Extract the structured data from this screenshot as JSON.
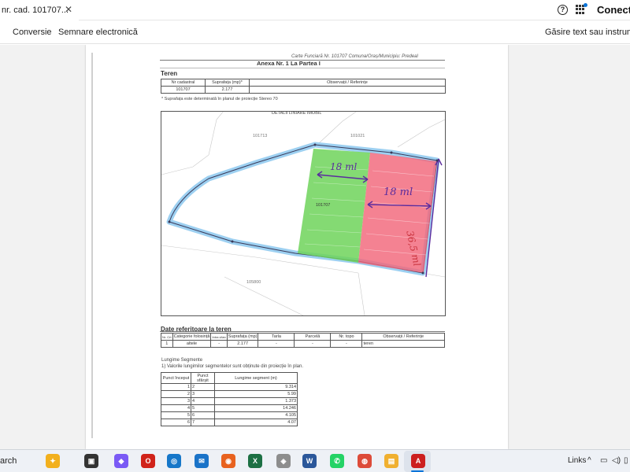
{
  "browser": {
    "tab_title": "nr. cad. 101707...",
    "tab_close": "✕",
    "help": "?",
    "profile_button": "Conecta"
  },
  "toolbar": {
    "conversion": "Conversie",
    "signatures": "Semnare electronică",
    "find_tools": "Găsire text sau instrumente"
  },
  "document": {
    "header_ref": "Carte Funciară Nr. 101707 Comuna/Oraș/Municipiu: Predeal",
    "annex_title": "Anexa Nr. 1 La Partea I",
    "teren_title": "Teren",
    "teren_headers": [
      "Nr cadastral",
      "Suprafața (mp)*",
      "Observații / Referințe"
    ],
    "teren_row": [
      "101707",
      "2.177",
      ""
    ],
    "stereo_note": "* Suprafața este determinată în planul de proiecție Stereo 70",
    "plan_title": "DETALII LINIARE IMOBIL",
    "parcel_label": "101707",
    "neighbor_labels": [
      "101713",
      "101021",
      "105800"
    ],
    "handwritten_width_1": "18 ml",
    "handwritten_width_2": "18 ml",
    "handwritten_depth": "36,5 ml",
    "date_ref_title": "Date referitoare la teren",
    "date_ref_headers": [
      "Nr. Crt",
      "Categorie folosință",
      "Intra vilan",
      "Suprafața (mp)",
      "Tarla",
      "Parcelă",
      "Nr. topo",
      "Observații / Referințe"
    ],
    "date_ref_row": [
      "1",
      "altele",
      "-",
      "2.177",
      "-",
      "-",
      "-",
      "teren"
    ],
    "segments_title": "Lungime Segmente",
    "segments_note": "1) Valorile lungimilor segmentelor sunt obținute din proiecție în plan.",
    "segments_headers": [
      "Punct început",
      "Punct sfârșit",
      "Lungime segment (m)"
    ],
    "segments_rows": [
      [
        "1",
        "2",
        "9.314"
      ],
      [
        "2",
        "3",
        "5.99"
      ],
      [
        "3",
        "4",
        "1.373"
      ],
      [
        "4",
        "5",
        "14.246"
      ],
      [
        "5",
        "6",
        "4.105"
      ],
      [
        "6",
        "7",
        "4.07"
      ]
    ]
  },
  "taskbar": {
    "search": "arch",
    "links": "Links",
    "apps": [
      {
        "name": "copilot",
        "label": "✦",
        "color": "#f2b01e"
      },
      {
        "name": "task-view",
        "label": "▣",
        "color": "#333333"
      },
      {
        "name": "copilot-app",
        "label": "◆",
        "color": "#7a5af5"
      },
      {
        "name": "opera",
        "label": "O",
        "color": "#d0231a"
      },
      {
        "name": "app-blue",
        "label": "◎",
        "color": "#1677c9"
      },
      {
        "name": "outlook",
        "label": "✉",
        "color": "#1a73c8"
      },
      {
        "name": "firefox",
        "label": "◉",
        "color": "#e8621f"
      },
      {
        "name": "excel",
        "label": "X",
        "color": "#1d7044"
      },
      {
        "name": "app-gray",
        "label": "◈",
        "color": "#8d8d8d"
      },
      {
        "name": "word",
        "label": "W",
        "color": "#2b579a"
      },
      {
        "name": "whatsapp",
        "label": "✆",
        "color": "#25d366"
      },
      {
        "name": "chrome",
        "label": "◍",
        "color": "#dd4b39"
      },
      {
        "name": "file-explorer",
        "label": "▤",
        "color": "#f0b030"
      },
      {
        "name": "acrobat",
        "label": "A",
        "color": "#cc1f1f"
      }
    ]
  },
  "colors": {
    "green_zone": "#6fd45a",
    "red_zone": "#f2667a",
    "blue_outline": "#8cc8ef",
    "handwriting": "#5b2c9e"
  }
}
